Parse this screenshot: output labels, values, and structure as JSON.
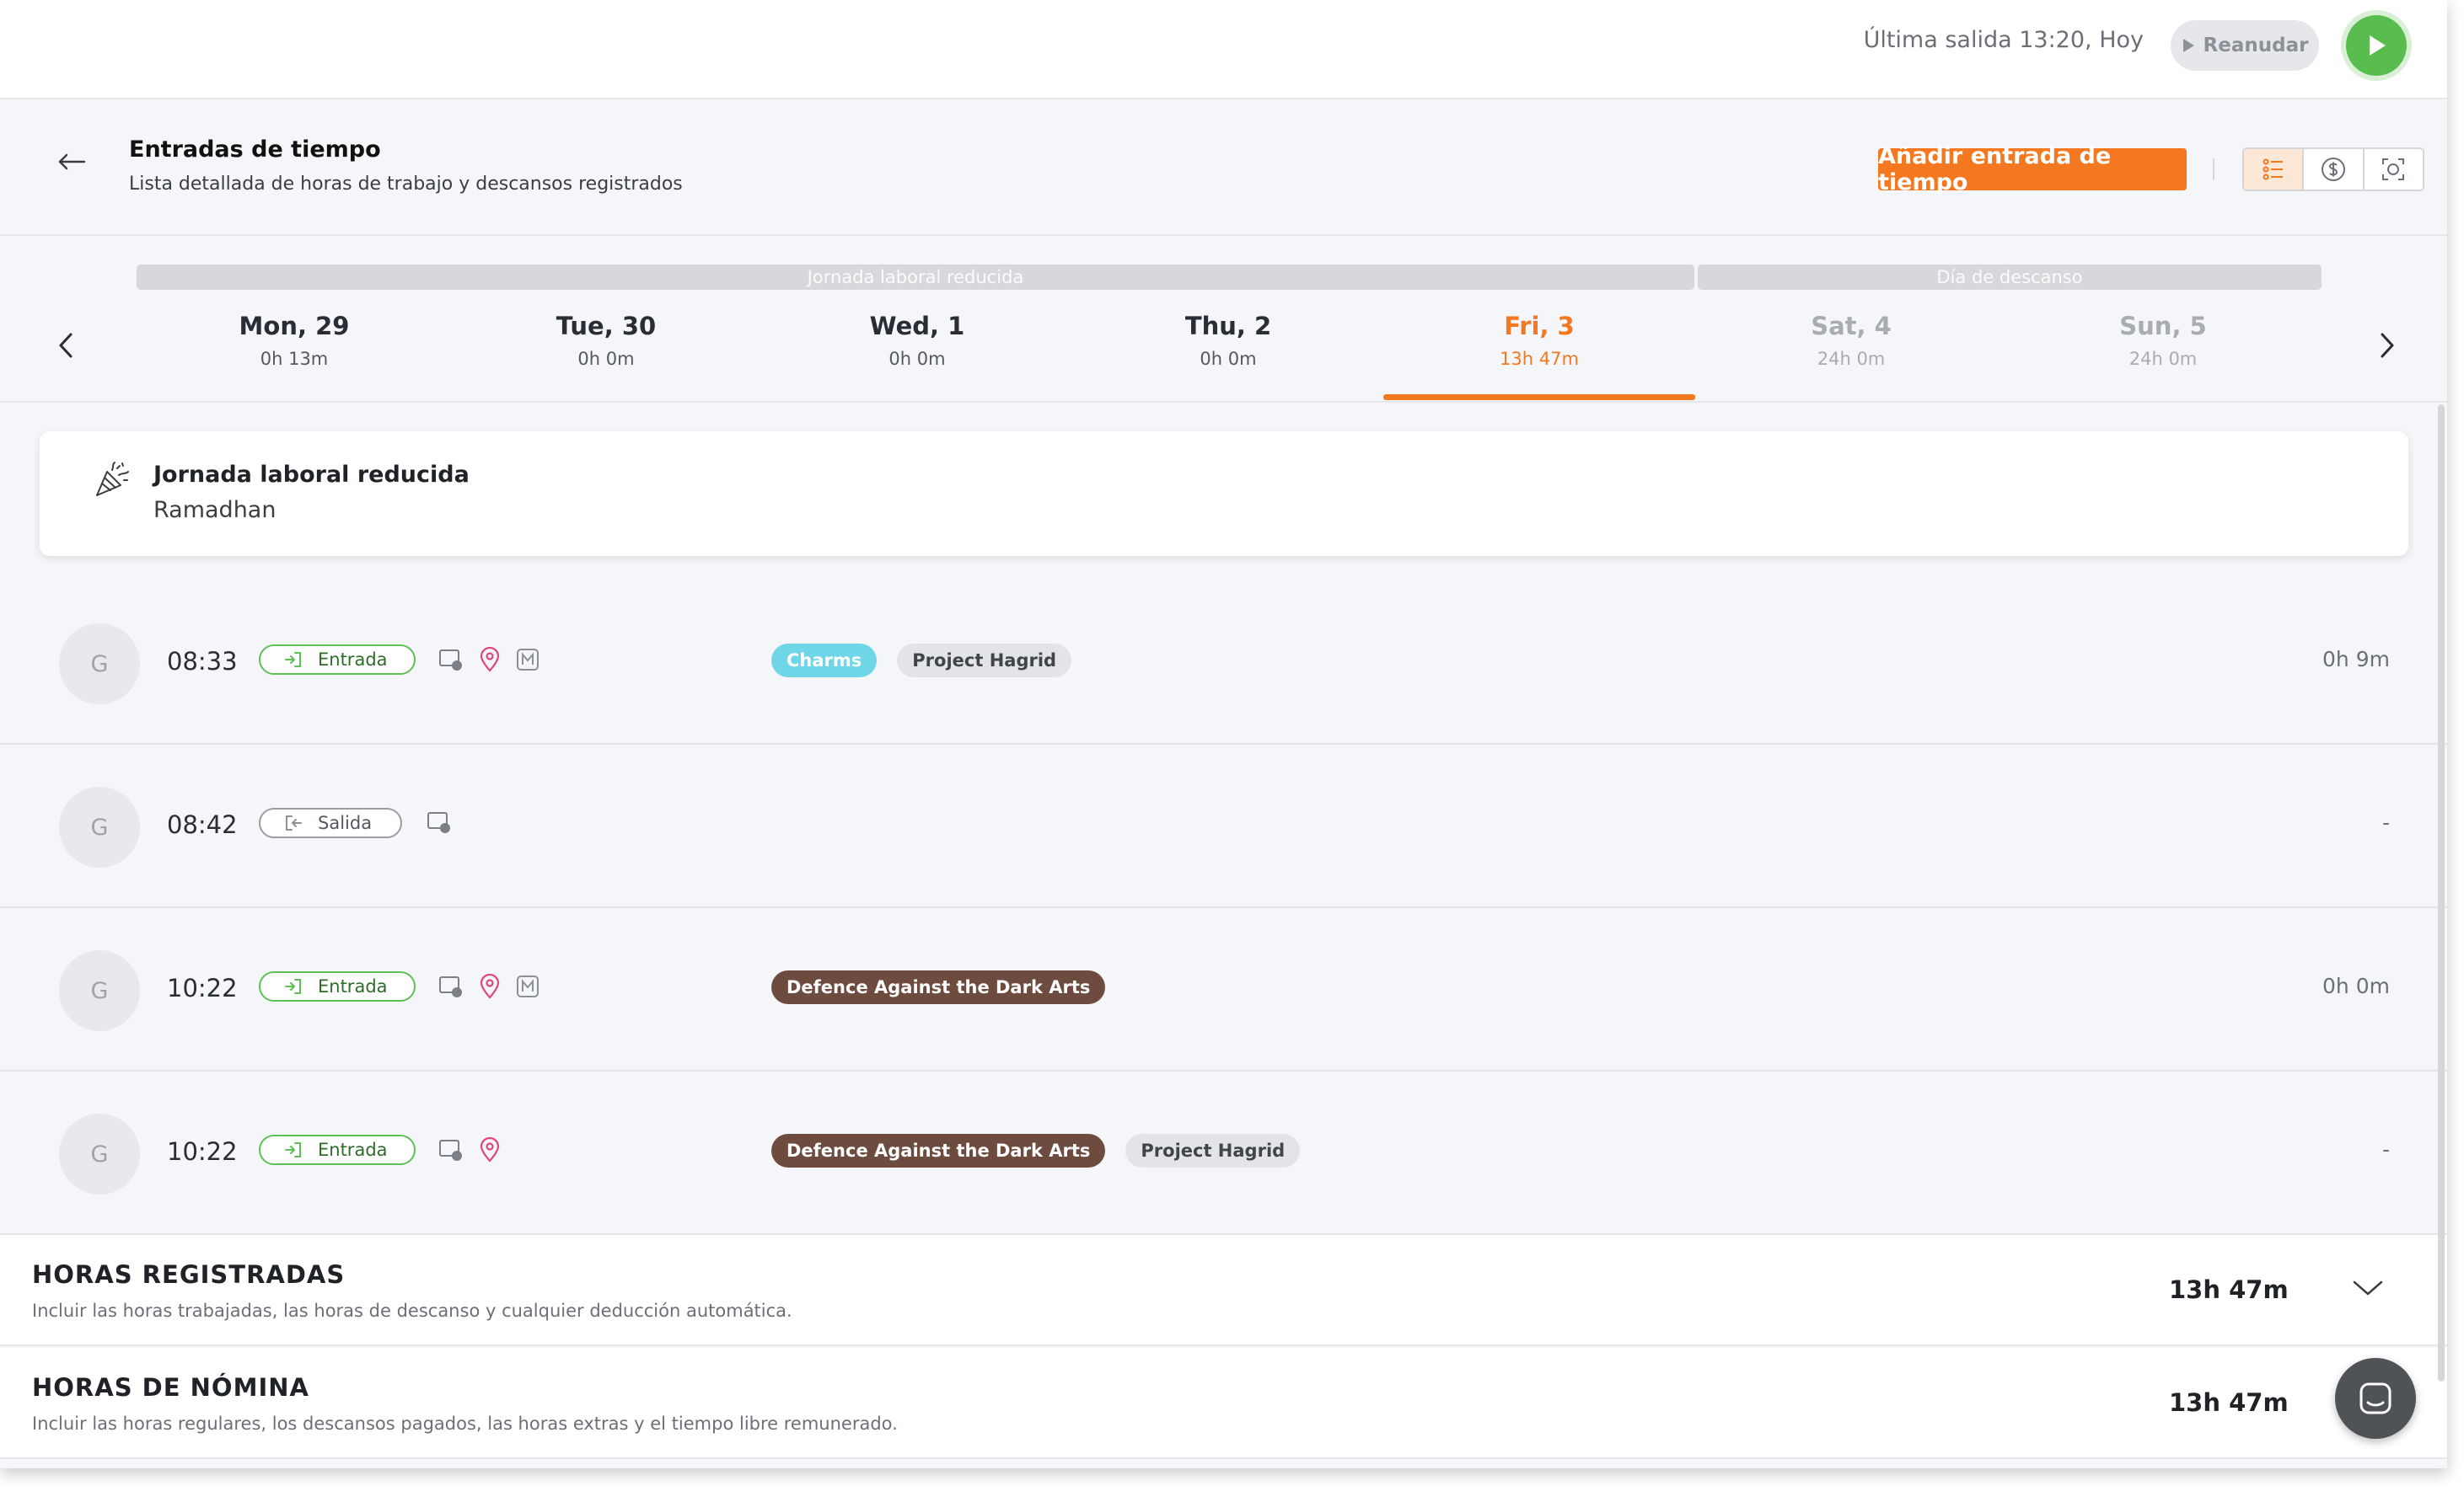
{
  "topbar": {
    "last_out": "Última salida 13:20, Hoy",
    "resume_label": "Reanudar"
  },
  "header": {
    "title": "Entradas de tiempo",
    "subtitle": "Lista detallada de horas de trabajo y descansos registrados",
    "add_button": "Añadir entrada de tiempo"
  },
  "week": {
    "bands": [
      "Jornada laboral reducida",
      "Día de descanso"
    ],
    "days": [
      {
        "name": "Mon, 29",
        "hours": "0h 13m"
      },
      {
        "name": "Tue, 30",
        "hours": "0h 0m"
      },
      {
        "name": "Wed, 1",
        "hours": "0h 0m"
      },
      {
        "name": "Thu, 2",
        "hours": "0h 0m"
      },
      {
        "name": "Fri, 3",
        "hours": "13h 47m"
      },
      {
        "name": "Sat, 4",
        "hours": "24h 0m"
      },
      {
        "name": "Sun, 5",
        "hours": "24h 0m"
      }
    ],
    "active_day": "Fri, 3"
  },
  "holiday": {
    "title": "Jornada laboral reducida",
    "subtitle": "Ramadhan"
  },
  "entries": [
    {
      "avatar": "G",
      "time": "08:33",
      "type": "Entrada",
      "tags": [
        "Charms",
        "Project Hagrid"
      ],
      "duration": "0h 9m"
    },
    {
      "avatar": "G",
      "time": "08:42",
      "type": "Salida",
      "tags": [],
      "duration": "-"
    },
    {
      "avatar": "G",
      "time": "10:22",
      "type": "Entrada",
      "tags": [
        "Defence Against the Dark Arts"
      ],
      "duration": "0h 0m"
    },
    {
      "avatar": "G",
      "time": "10:22",
      "type": "Entrada",
      "tags": [
        "Defence Against the Dark Arts",
        "Project Hagrid"
      ],
      "duration": "-"
    }
  ],
  "totals": [
    {
      "title": "HORAS REGISTRADAS",
      "desc": "Incluir las horas trabajadas, las horas de descanso y cualquier deducción automática.",
      "value": "13h 47m"
    },
    {
      "title": "HORAS DE NÓMINA",
      "desc": "Incluir las horas regulares, los descansos pagados, las horas extras y el tiempo libre remunerado.",
      "value": "13h 47m"
    }
  ],
  "colors": {
    "accent": "#f47820",
    "clock_in_green": "#5fbf57",
    "play_green": "#58bc4f",
    "tag_charms": "#6fd6e8",
    "tag_dada": "#6d4b3e",
    "tag_project": "#e3e4e7"
  },
  "icons": [
    "back-arrow-icon",
    "play-icon",
    "list-view-icon",
    "dollar-icon",
    "scan-icon",
    "chevron-left-icon",
    "chevron-right-icon",
    "party-popper-icon",
    "clock-in-icon",
    "clock-out-icon",
    "device-icon",
    "location-pin-icon",
    "manual-icon",
    "chevron-down-icon",
    "chat-icon"
  ]
}
